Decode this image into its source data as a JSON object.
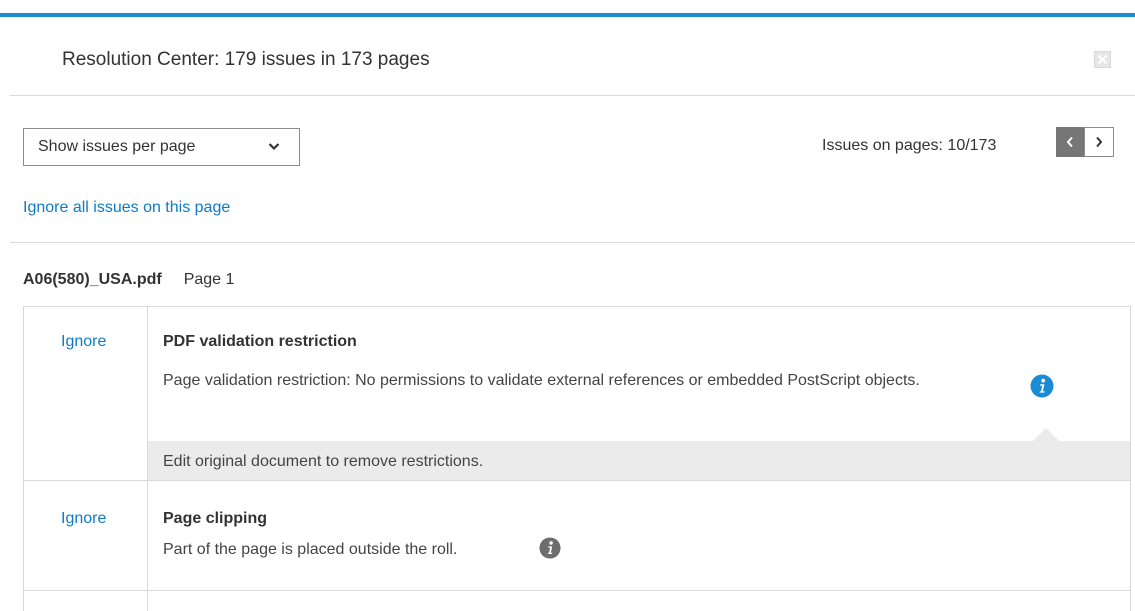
{
  "header": {
    "title": "Resolution Center: 179 issues in 173 pages",
    "close_icon": "close-icon"
  },
  "toolbar": {
    "view_select": {
      "selected": "Show issues per page",
      "icon": "chevron-down-icon"
    },
    "pages_label": "Issues on pages: 10/173",
    "prev_icon": "chevron-left-icon",
    "next_icon": "chevron-right-icon"
  },
  "ignore_all_link": "Ignore all issues on this page",
  "file": {
    "name": "A06(580)_USA.pdf",
    "page": "Page 1"
  },
  "issues": [
    {
      "ignore_label": "Ignore",
      "title": "PDF validation restriction",
      "description": "Page validation restriction: No permissions to validate external references or embedded PostScript objects.",
      "info_icon": "info-icon",
      "info_color": "#1b8bd6",
      "fix": "Edit original document to remove restrictions."
    },
    {
      "ignore_label": "Ignore",
      "title": "Page clipping",
      "description": "Part of the page is placed outside the roll.",
      "info_icon": "info-icon",
      "info_color": "#6d6d6d"
    }
  ],
  "colors": {
    "accent": "#1b8bd6",
    "link": "#0d7bc9",
    "pager_active": "#767676"
  }
}
